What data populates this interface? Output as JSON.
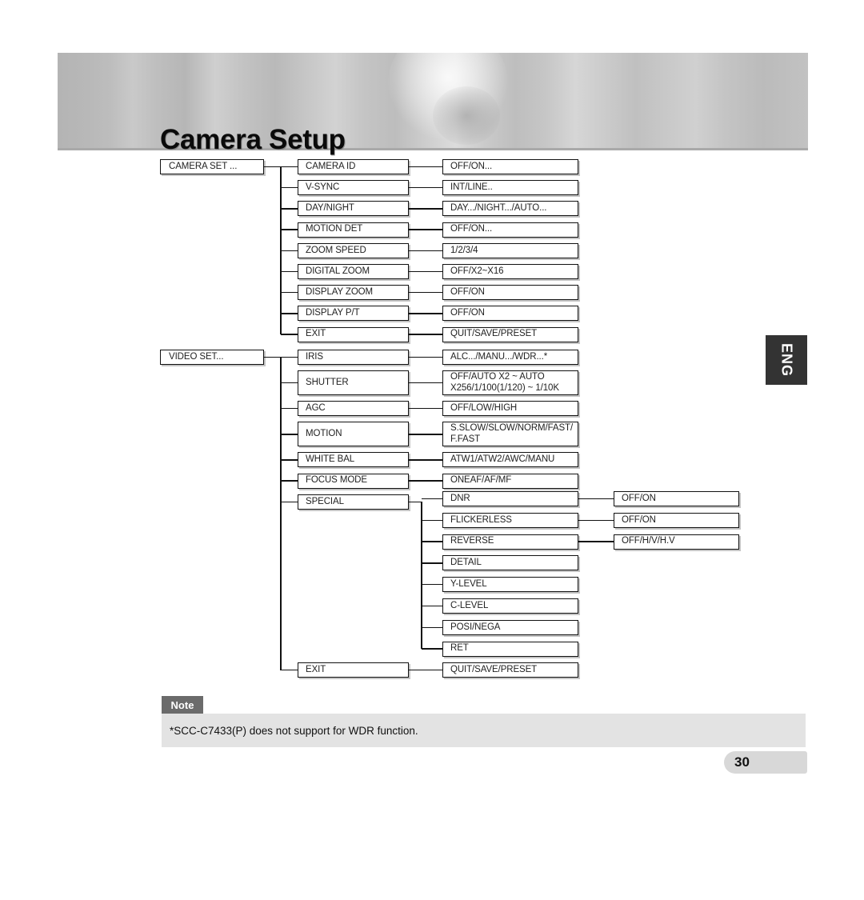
{
  "header": {
    "title": "Camera Setup"
  },
  "side_tab": {
    "label": "ENG"
  },
  "page_number": "30",
  "note": {
    "label": "Note",
    "text": "*SCC-C7433(P) does not support for WDR function."
  },
  "diagram": {
    "type": "menu-tree",
    "roots": [
      {
        "id": "camera-set",
        "label": "CAMERA SET ..."
      },
      {
        "id": "video-set",
        "label": "VIDEO SET..."
      }
    ],
    "camera_set_items": [
      {
        "label": "CAMERA ID",
        "value": "OFF/ON..."
      },
      {
        "label": "V-SYNC",
        "value": "INT/LINE.."
      },
      {
        "label": "DAY/NIGHT",
        "value": "DAY.../NIGHT.../AUTO..."
      },
      {
        "label": "MOTION DET",
        "value": "OFF/ON..."
      },
      {
        "label": "ZOOM SPEED",
        "value": "1/2/3/4"
      },
      {
        "label": "DIGITAL ZOOM",
        "value": "OFF/X2~X16"
      },
      {
        "label": "DISPLAY ZOOM",
        "value": "OFF/ON"
      },
      {
        "label": "DISPLAY P/T",
        "value": "OFF/ON"
      },
      {
        "label": "EXIT",
        "value": "QUIT/SAVE/PRESET"
      }
    ],
    "video_set_items": [
      {
        "label": "IRIS",
        "value": "ALC.../MANU.../WDR...*"
      },
      {
        "label": "SHUTTER",
        "value": "OFF/AUTO X2 ~ AUTO\nX256/1/100(1/120) ~ 1/10K"
      },
      {
        "label": "AGC",
        "value": "OFF/LOW/HIGH"
      },
      {
        "label": "MOTION",
        "value": "S.SLOW/SLOW/NORM/FAST/\nF.FAST"
      },
      {
        "label": "WHITE BAL",
        "value": "ATW1/ATW2/AWC/MANU"
      },
      {
        "label": "FOCUS MODE",
        "value": "ONEAF/AF/MF"
      },
      {
        "label": "SPECIAL",
        "value": ""
      }
    ],
    "special_items": [
      {
        "label": "DNR",
        "value": "OFF/ON"
      },
      {
        "label": "FLICKERLESS",
        "value": "OFF/ON"
      },
      {
        "label": "REVERSE",
        "value": "OFF/H/V/H.V"
      },
      {
        "label": "DETAIL",
        "value": ""
      },
      {
        "label": "Y-LEVEL",
        "value": ""
      },
      {
        "label": "C-LEVEL",
        "value": ""
      },
      {
        "label": "POSI/NEGA",
        "value": ""
      },
      {
        "label": "RET",
        "value": ""
      }
    ],
    "video_exit": {
      "label": "EXIT",
      "value": "QUIT/SAVE/PRESET"
    }
  },
  "colors": {
    "line": "#111111",
    "box_border": "#111111",
    "box_shadow": "#c4c4c4",
    "note_label_bg": "#6b6b6b",
    "note_body_bg": "#e3e3e3",
    "eng_tab_bg": "#333333",
    "page_badge_bg": "#d8d8d8",
    "banner_base": "#c2c2c2"
  }
}
